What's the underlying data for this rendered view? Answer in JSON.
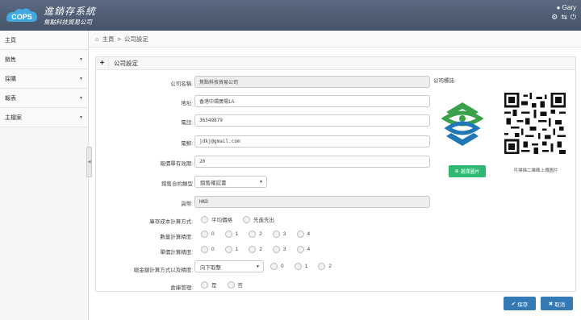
{
  "header": {
    "logo_text": "COPS",
    "app_title": "進銷存系統",
    "company": "焦點科技貿易公司",
    "user_name": "Gary",
    "user_icon": "user-icon",
    "icons": [
      "gear-icon",
      "exchange-icon",
      "power-icon"
    ],
    "bg_color": "#4e5c72"
  },
  "sidebar": {
    "items": [
      {
        "label": "主頁",
        "has_caret": false
      },
      {
        "label": "銷售",
        "has_caret": true
      },
      {
        "label": "採購",
        "has_caret": true
      },
      {
        "label": "報表",
        "has_caret": true
      },
      {
        "label": "主檔案",
        "has_caret": true
      }
    ]
  },
  "breadcrumb": {
    "home_icon": "home-icon",
    "home": "主頁",
    "separator": ">",
    "current": "公司設定"
  },
  "panel": {
    "title": "公司設定"
  },
  "form": {
    "company_name": {
      "label": "公司名稱:",
      "value": "焦點科技貿易公司"
    },
    "address": {
      "label": "地址:",
      "value": "香港中環廣場1A"
    },
    "phone": {
      "label": "電話:",
      "value": "36549879"
    },
    "email": {
      "label": "電郵:",
      "value": "jdkj@gmail.com"
    },
    "quote_valid": {
      "label": "報價單有效期:",
      "value": "20"
    },
    "contract_type": {
      "label": "銷售合約類型",
      "value": "銷售確認書"
    },
    "currency": {
      "label": "貨幣:",
      "value": "HKD"
    },
    "cost_method": {
      "label": "庫存成本計算方式:",
      "options": [
        "平均價格",
        "先進先出"
      ]
    },
    "qty_precision": {
      "label": "數量計算精度:",
      "options": [
        "0",
        "1",
        "2",
        "3",
        "4"
      ]
    },
    "price_precision": {
      "label": "單價計算精度:",
      "options": [
        "0",
        "1",
        "2",
        "3",
        "4"
      ]
    },
    "amount_method": {
      "label": "總金額計算方式以及精度:",
      "value": "向下取整",
      "options": [
        "0",
        "1",
        "2"
      ]
    },
    "warehouse": {
      "label": "倉庫管理:",
      "options": [
        "是",
        "否"
      ]
    }
  },
  "logo_section": {
    "label": "公司標誌:",
    "select_button": "選擇圖片",
    "qr_caption": "可掃描二維碼上傳圖片",
    "logo_green": "#3aa14a",
    "logo_blue": "#1f77b8"
  },
  "actions": {
    "save": "保存",
    "cancel": "取消",
    "accent": "#337ab7"
  }
}
